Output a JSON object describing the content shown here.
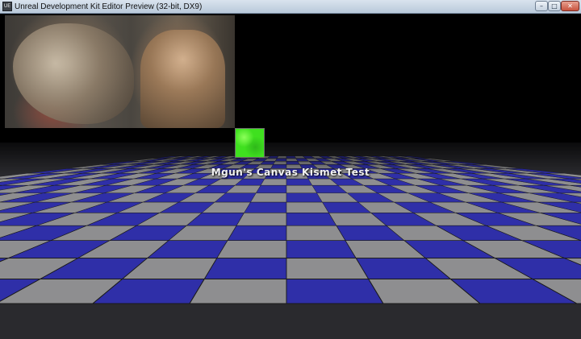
{
  "window": {
    "title": "Unreal Development Kit Editor Preview (32-bit, DX9)",
    "app_icon_glyph": "UE",
    "minimize_glyph": "–",
    "maximize_glyph": "□",
    "close_glyph": "✕"
  },
  "scene": {
    "caption": "Mgun's Canvas Kismet Test",
    "floor_colors": {
      "blue": "#2f2fa8",
      "gray": "#8e8e90",
      "background": "#000000"
    },
    "tile_color": "#3fe01f"
  }
}
